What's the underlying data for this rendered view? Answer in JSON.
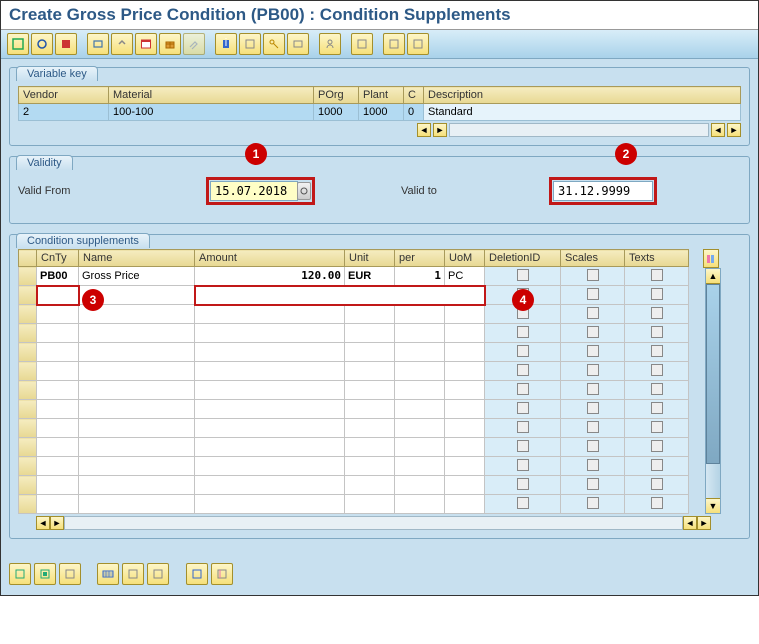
{
  "title": "Create Gross Price Condition (PB00) : Condition Supplements",
  "vk": {
    "label": "Variable key",
    "headers": {
      "vendor": "Vendor",
      "material": "Material",
      "porg": "POrg",
      "plant": "Plant",
      "c": "C",
      "desc": "Description"
    },
    "row": {
      "vendor": "2",
      "material": "100-100",
      "porg": "1000",
      "plant": "1000",
      "c": "0",
      "desc": "Standard"
    }
  },
  "validity": {
    "label": "Validity",
    "from_label": "Valid From",
    "from_value": "15.07.2018",
    "to_label": "Valid to",
    "to_value": "31.12.9999"
  },
  "markers": {
    "m1": "1",
    "m2": "2",
    "m3": "3",
    "m4": "4"
  },
  "cond": {
    "label": "Condition supplements",
    "headers": {
      "cnty": "CnTy",
      "name": "Name",
      "amount": "Amount",
      "unit": "Unit",
      "per": "per",
      "uom": "UoM",
      "delid": "DeletionID",
      "scales": "Scales",
      "texts": "Texts"
    },
    "row1": {
      "cnty": "PB00",
      "name": "Gross Price",
      "amount": "120.00",
      "unit": "EUR",
      "per": "1",
      "uom": "PC"
    }
  }
}
